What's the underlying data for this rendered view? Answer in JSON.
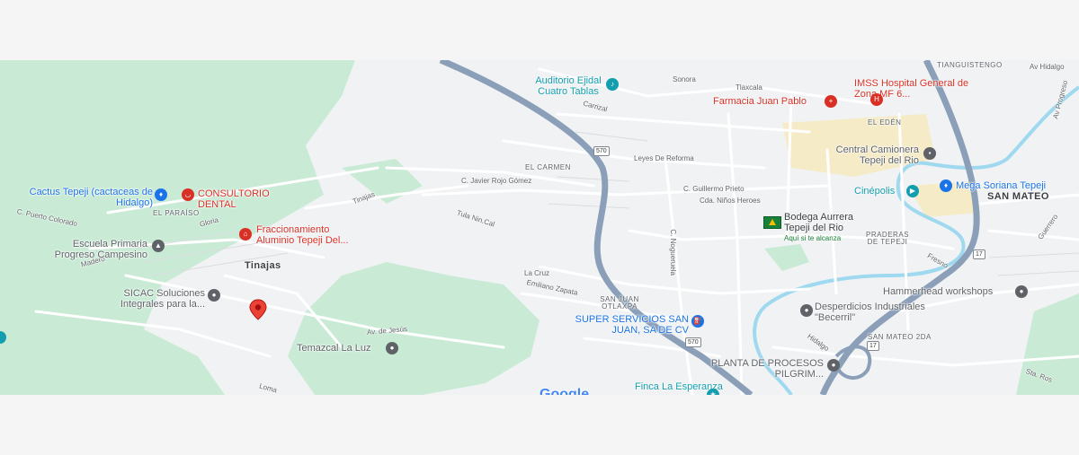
{
  "map": {
    "colors": {
      "background": "#f1f2f4",
      "park": "#c9ebd5",
      "water": "#9fd9f0",
      "highway": "#8ba0b8",
      "urban": "#f6ebc7",
      "street": "#ffffff"
    },
    "towns": [
      {
        "name": "Tinajas"
      },
      {
        "name": "SAN MATEO"
      }
    ],
    "neighborhoods": [
      "EL CARMEN",
      "EL PARAÍSO",
      "EL EDÉN",
      "SAN JUAN OTLAXPA",
      "PRADERAS DE TEPEJI",
      "SAN MATEO 2DA",
      "TIANGUISTENGO"
    ],
    "streets": [
      "Sonora",
      "Tlaxcala",
      "Carrizal",
      "Leyes De Reforma",
      "C. Javier Rojo Gómez",
      "C. Guillermo Prieto",
      "Cda. Niños Heroes",
      "Tula Nin.Cal",
      "Tinajas",
      "Gloria",
      "C. Puerto Colorado",
      "Madero",
      "La Cruz",
      "Emiliano Zapata",
      "C. Nogueruela",
      "Av. de Jesús",
      "Fresno",
      "Hidalgo",
      "Sta. Ros",
      "Av Hidalgo",
      "Loma",
      "Guerrero",
      "Av Progreso"
    ],
    "highway_shields": [
      "570",
      "570",
      "17",
      "17"
    ],
    "places": [
      {
        "name": "Auditorio Ejidal Cuatro Tablas",
        "icon": "theater-icon",
        "color": "#129eaf"
      },
      {
        "name": "IMSS Hospital General de Zona MF 6...",
        "icon": "hospital-icon",
        "color": "#d93025"
      },
      {
        "name": "Farmacia Juan Pablo",
        "icon": "pharmacy-icon",
        "color": "#d93025"
      },
      {
        "name": "Central Camionera Tepeji del Rio",
        "icon": "bus-station-icon",
        "color": "#5f6368"
      },
      {
        "name": "Cinépolis",
        "icon": "cinema-icon",
        "color": "#129eaf"
      },
      {
        "name": "Mega Soriana Tepeji",
        "icon": "shopping-icon",
        "color": "#1a73e8"
      },
      {
        "name": "Bodega Aurrera Tepeji del Rio",
        "sub": "Aquí si te alcanza",
        "icon": "store-logo-icon",
        "color": "#3c4043"
      },
      {
        "name": "Cactus Tepeji (cactaceas de Hidalgo)",
        "icon": "shopping-icon",
        "color": "#1a73e8"
      },
      {
        "name": "CONSULTORIO DENTAL",
        "icon": "dental-icon",
        "color": "#d93025"
      },
      {
        "name": "Fraccionamiento Aluminio Tepeji Del...",
        "icon": "home-icon",
        "color": "#d93025"
      },
      {
        "name": "Escuela Primaria Progreso Campesino",
        "icon": "school-icon",
        "color": "#5f6368"
      },
      {
        "name": "SICAC Soluciones Integrales para la...",
        "icon": "location-icon",
        "color": "#5f6368"
      },
      {
        "name": "Temazcal La Luz",
        "icon": "location-icon",
        "color": "#5f6368"
      },
      {
        "name": "SUPER SERVICIOS SAN JUAN, SA DE CV",
        "icon": "gas-station-icon",
        "color": "#1a73e8"
      },
      {
        "name": "Hammerhead workshops",
        "icon": "location-icon",
        "color": "#5f6368"
      },
      {
        "name": "Desperdicios Industriales \"Becerril\"",
        "icon": "location-icon",
        "color": "#5f6368"
      },
      {
        "name": "PLANTA DE PROCESOS PILGRIM...",
        "icon": "location-icon",
        "color": "#5f6368"
      },
      {
        "name": "Finca La Esperanza",
        "icon": "event-venue-icon",
        "color": "#129eaf"
      }
    ],
    "logo": "Google"
  }
}
